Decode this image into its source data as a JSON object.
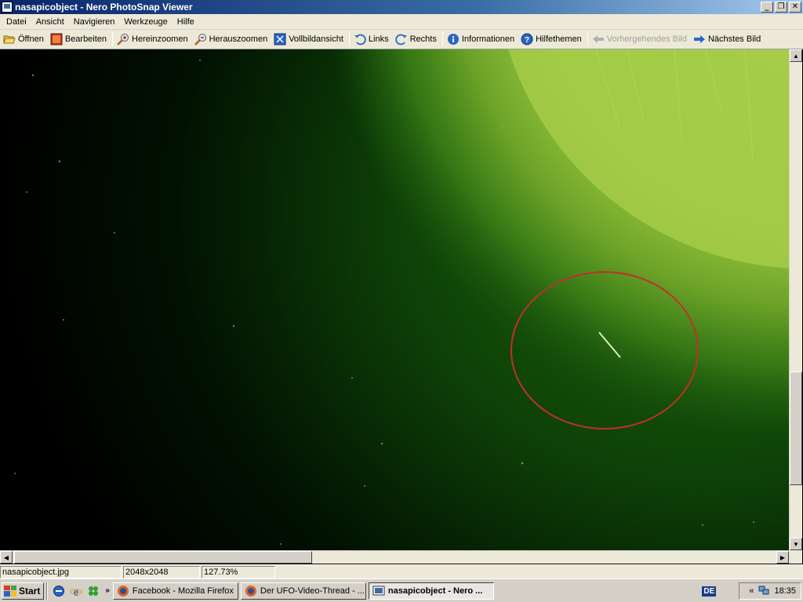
{
  "window": {
    "title": "nasapicobject - Nero PhotoSnap Viewer",
    "minimize": "_",
    "restore": "❐",
    "close": "✕"
  },
  "menu": [
    "Datei",
    "Ansicht",
    "Navigieren",
    "Werkzeuge",
    "Hilfe"
  ],
  "toolbar": {
    "open": "Öffnen",
    "edit": "Bearbeiten",
    "zoom_in": "Hereinzoomen",
    "zoom_out": "Herauszoomen",
    "fullscreen": "Vollbildansicht",
    "rotate_left": "Links",
    "rotate_right": "Rechts",
    "info": "Informationen",
    "help": "Hilfethemen",
    "prev": "Vorhergehendes Bild",
    "next": "Nächstes Bild"
  },
  "status": {
    "filename": "nasapicobject.jpg",
    "dimensions": "2048x2048",
    "zoom": "127.73%"
  },
  "taskbar": {
    "start": "Start",
    "chevron": "»",
    "tasks": [
      {
        "label": "Facebook - Mozilla Firefox",
        "active": false
      },
      {
        "label": "Der UFO-Video-Thread - ...",
        "active": false
      },
      {
        "label": "nasapicobject - Nero ...",
        "active": true
      }
    ],
    "language": "DE",
    "tray_chevron": "«",
    "clock": "18:35"
  },
  "colors": {
    "titlebar": "#0a246a",
    "circle": "#c0302a",
    "sun": "#9cc840"
  }
}
